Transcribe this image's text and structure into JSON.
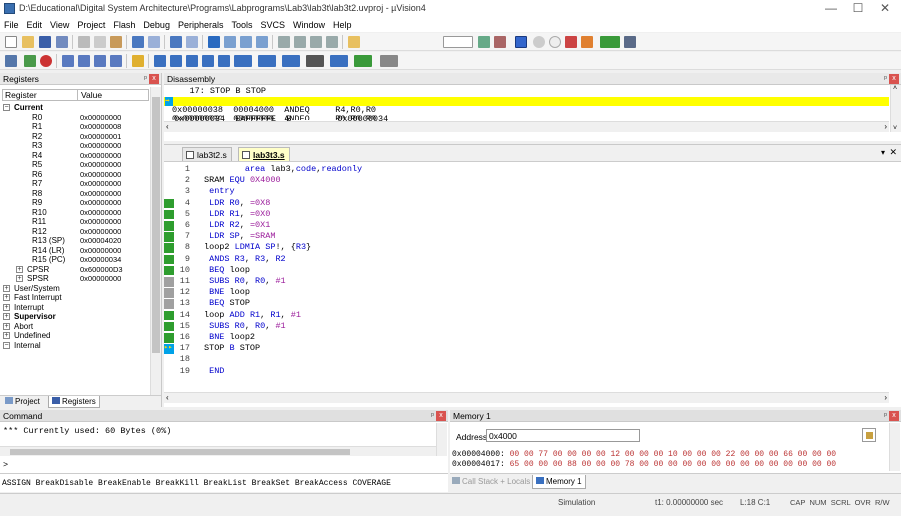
{
  "window": {
    "title": "D:\\Educational\\Digital System Architecture\\Programs\\Labprograms\\Lab3\\lab3t\\lab3t2.uvproj - µVision4",
    "min": "—",
    "max": "☐",
    "close": "✕"
  },
  "menu": [
    "File",
    "Edit",
    "View",
    "Project",
    "Flash",
    "Debug",
    "Peripherals",
    "Tools",
    "SVCS",
    "Window",
    "Help"
  ],
  "registers": {
    "title": "Registers",
    "col_register": "Register",
    "col_value": "Value",
    "current_label": "Current",
    "rows": [
      {
        "name": "R0",
        "value": "0x00000000"
      },
      {
        "name": "R1",
        "value": "0x00000008"
      },
      {
        "name": "R2",
        "value": "0x00000001"
      },
      {
        "name": "R3",
        "value": "0x00000000"
      },
      {
        "name": "R4",
        "value": "0x00000000"
      },
      {
        "name": "R5",
        "value": "0x00000000"
      },
      {
        "name": "R6",
        "value": "0x00000000"
      },
      {
        "name": "R7",
        "value": "0x00000000"
      },
      {
        "name": "R8",
        "value": "0x00000000"
      },
      {
        "name": "R9",
        "value": "0x00000000"
      },
      {
        "name": "R10",
        "value": "0x00000000"
      },
      {
        "name": "R11",
        "value": "0x00000000"
      },
      {
        "name": "R12",
        "value": "0x00000000"
      },
      {
        "name": "R13 (SP)",
        "value": "0x00004020"
      },
      {
        "name": "R14 (LR)",
        "value": "0x00000000"
      },
      {
        "name": "R15 (PC)",
        "value": "0x00000034"
      },
      {
        "name": "CPSR",
        "value": "0x600000D3"
      },
      {
        "name": "SPSR",
        "value": "0x00000000"
      }
    ],
    "modes": [
      {
        "name": "User/System",
        "bold": false
      },
      {
        "name": "Fast Interrupt",
        "bold": false
      },
      {
        "name": "Interrupt",
        "bold": false
      },
      {
        "name": "Supervisor",
        "bold": true
      },
      {
        "name": "Abort",
        "bold": false
      },
      {
        "name": "Undefined",
        "bold": false
      },
      {
        "name": "Internal",
        "bold": false
      }
    ],
    "tab_project": "Project",
    "tab_registers": "Registers"
  },
  "disassembly": {
    "title": "Disassembly",
    "lines": [
      "     17: STOP B STOP",
      "0x00000034  EAFFFFFE  B         0x00000034",
      "0x00000038  00004000  ANDEQ     R4,R0,R0",
      "0x0000003C  00000000  ANDEQ     R0,R0,R0"
    ]
  },
  "editor": {
    "tabs": [
      "lab3t2.s",
      "lab3t3.s"
    ],
    "lines": [
      {
        "n": "1",
        "text": "        area lab3,code,readonly",
        "cov": ""
      },
      {
        "n": "2",
        "text": "SRAM EQU 0X4000",
        "cov": ""
      },
      {
        "n": "3",
        "text": " entry",
        "cov": ""
      },
      {
        "n": "4",
        "text": " LDR R0, =0X8",
        "cov": "green"
      },
      {
        "n": "5",
        "text": " LDR R1, =0X0",
        "cov": "green"
      },
      {
        "n": "6",
        "text": " LDR R2, =0X1",
        "cov": "green"
      },
      {
        "n": "7",
        "text": " LDR SP, =SRAM",
        "cov": "green"
      },
      {
        "n": "8",
        "text": "loop2 LDMIA SP!, {R3}",
        "cov": "green"
      },
      {
        "n": "9",
        "text": " ANDS R3, R3, R2",
        "cov": "green"
      },
      {
        "n": "10",
        "text": " BEQ loop",
        "cov": "green"
      },
      {
        "n": "11",
        "text": " SUBS R0, R0, #1",
        "cov": "gray"
      },
      {
        "n": "12",
        "text": " BNE loop",
        "cov": "gray"
      },
      {
        "n": "13",
        "text": " BEQ STOP",
        "cov": "gray"
      },
      {
        "n": "14",
        "text": "loop ADD R1, R1, #1",
        "cov": "green"
      },
      {
        "n": "15",
        "text": " SUBS R0, R0, #1",
        "cov": "green"
      },
      {
        "n": "16",
        "text": " BNE loop2",
        "cov": "green"
      },
      {
        "n": "17",
        "text": "STOP B STOP",
        "cov": "current"
      },
      {
        "n": "18",
        "text": "",
        "cov": ""
      },
      {
        "n": "19",
        "text": " END",
        "cov": ""
      }
    ]
  },
  "command": {
    "title": "Command",
    "output": "*** Currently used: 60 Bytes (0%)",
    "prompt": ">",
    "hints": "ASSIGN BreakDisable BreakEnable BreakKill BreakList BreakSet BreakAccess COVERAGE"
  },
  "memory": {
    "title": "Memory 1",
    "address_label": "Address:",
    "address_value": "0x4000",
    "rows": [
      {
        "addr": "0x00004000:",
        "bytes": "00 00 77 00 00 00 00 12 00 00 00 10 00 00 00 22 00 00 00 66 00 00 00"
      },
      {
        "addr": "0x00004017:",
        "bytes": "65 00 00 00 88 00 00 00 78 00 00 00 00 00 00 00 00 00 00 00 00 00 00"
      }
    ],
    "tab_callstack": "Call Stack + Locals",
    "tab_memory": "Memory 1"
  },
  "status": {
    "mode": "Simulation",
    "time": "t1: 0.00000000 sec",
    "pos": "L:18 C:1",
    "keys": "CAP  NUM  SCRL  OVR  R/W"
  },
  "colors": {
    "highlight_yellow": "#ffff00",
    "coverage_green": "#2e9d2e",
    "coverage_gray": "#a0a0a0",
    "current_arrow": "#00a2e8"
  }
}
